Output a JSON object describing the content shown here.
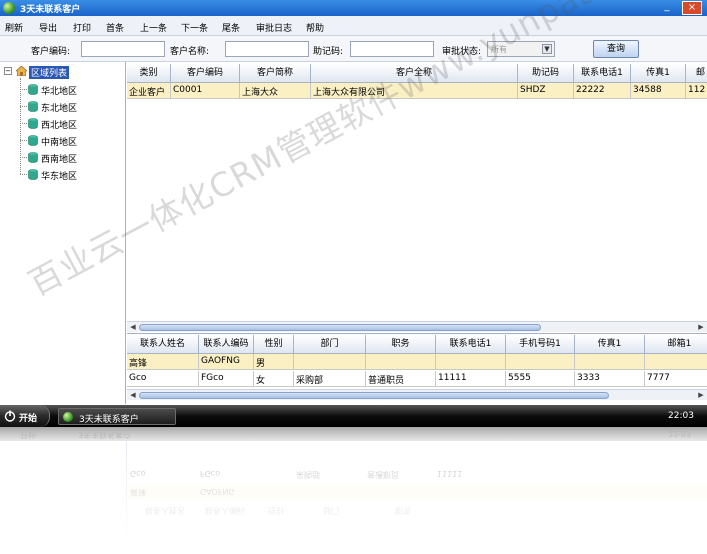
{
  "window": {
    "title": "3天未联系客户"
  },
  "menu": [
    "刷新",
    "导出",
    "打印",
    "首条",
    "上一条",
    "下一条",
    "尾条",
    "审批日志",
    "帮助"
  ],
  "filters": {
    "code_label": "客户编码:",
    "name_label": "客户名称:",
    "mnemonic_label": "助记码:",
    "status_label": "审批状态:",
    "status_value": "所有",
    "query_button": "查询"
  },
  "tree": {
    "root": "区域列表",
    "items": [
      "华北地区",
      "东北地区",
      "西北地区",
      "中南地区",
      "西南地区",
      "华东地区"
    ]
  },
  "customers": {
    "columns": [
      "类别",
      "客户编码",
      "客户简称",
      "客户全称",
      "助记码",
      "联系电话1",
      "传真1",
      "邮"
    ],
    "rows": [
      [
        "企业客户",
        "C0001",
        "上海大众",
        "上海大众有限公司",
        "SHDZ",
        "22222",
        "34588",
        "112"
      ]
    ]
  },
  "contacts": {
    "columns": [
      "联系人姓名",
      "联系人编码",
      "性别",
      "部门",
      "职务",
      "联系电话1",
      "手机号码1",
      "传真1",
      "邮箱1"
    ],
    "rows": [
      [
        "高锋",
        "GAOFNG",
        "男",
        "",
        "",
        "",
        "",
        "",
        ""
      ],
      [
        "Gco",
        "FGco",
        "女",
        "采购部",
        "普通职员",
        "11111",
        "5555",
        "3333",
        "7777"
      ]
    ]
  },
  "taskbar": {
    "start": "开始",
    "task": "3天未联系客户",
    "clock": "22:03"
  },
  "watermark": "百业云一体化CRM管理软件www.yunpaas.com",
  "colors": {
    "titlebar": "#2a7ad8",
    "selected_row": "#fbf0c4",
    "tree_selected": "#2b58b5",
    "taskbar": "#111111"
  }
}
